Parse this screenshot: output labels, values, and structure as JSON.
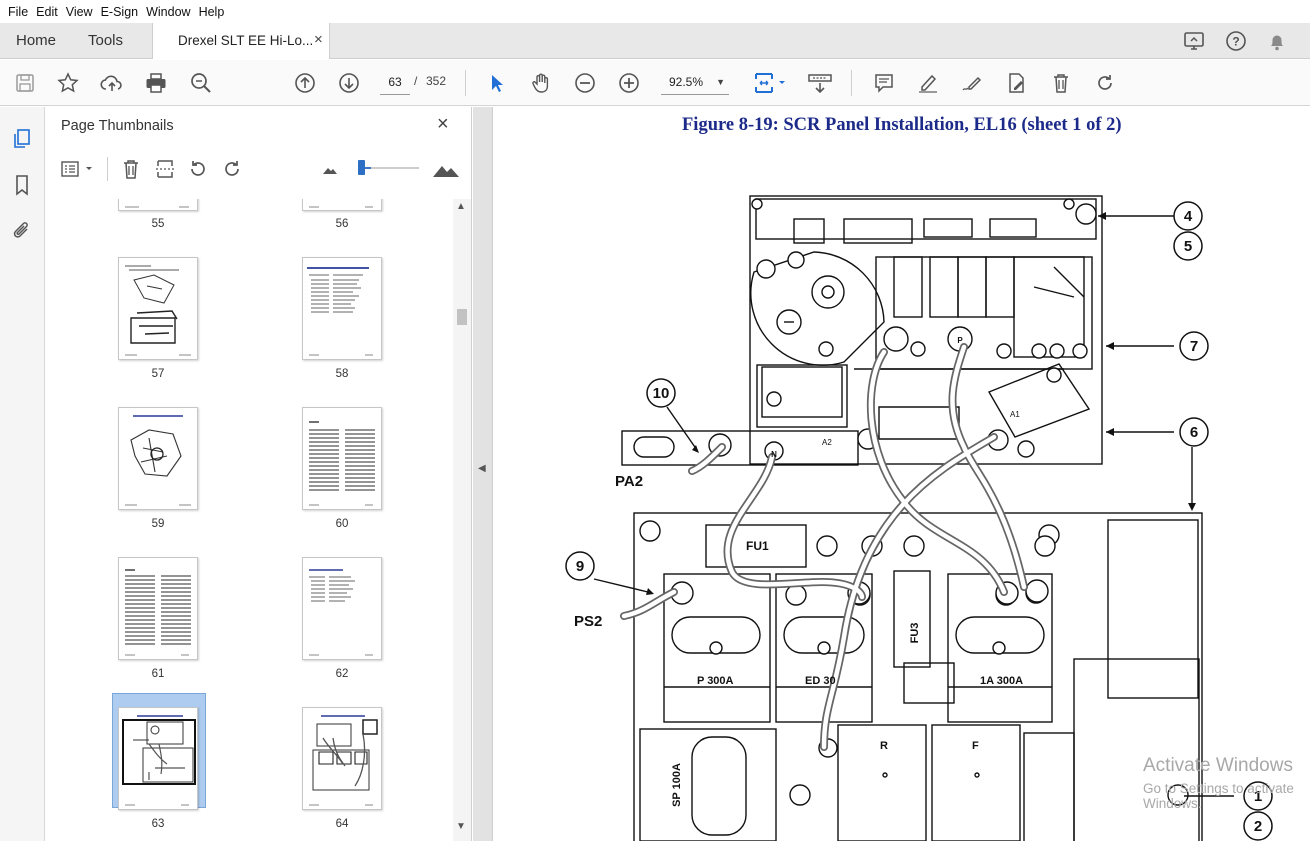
{
  "menu": [
    "File",
    "Edit",
    "View",
    "E-Sign",
    "Window",
    "Help"
  ],
  "tabs": {
    "home": "Home",
    "tools": "Tools",
    "document": "Drexel SLT EE Hi-Lo...",
    "close": "×"
  },
  "toolbar": {
    "current_page": "63",
    "page_separator": "/",
    "total_pages": "352",
    "zoom": "92.5%"
  },
  "panel": {
    "title": "Page Thumbnails",
    "close": "×",
    "zoom_slider_level": 0.1,
    "thumbnails": [
      {
        "page": "55"
      },
      {
        "page": "56"
      },
      {
        "page": "57"
      },
      {
        "page": "58"
      },
      {
        "page": "59"
      },
      {
        "page": "60"
      },
      {
        "page": "61"
      },
      {
        "page": "62"
      },
      {
        "page": "63",
        "selected": true
      },
      {
        "page": "64"
      }
    ]
  },
  "document": {
    "figure_title": "Figure 8-19:  SCR Panel Installation, EL16 (sheet 1 of 2)",
    "callouts": [
      "1",
      "2",
      "4",
      "5",
      "6",
      "7",
      "9",
      "10"
    ],
    "labels": {
      "pa2": "PA2",
      "ps2": "PS2",
      "fu1": "FU1",
      "fu3": "FU3",
      "p300a": "P 300A",
      "ed30": "ED 30",
      "a1_300a": "1A 300A",
      "sp100a": "SP 100A",
      "r": "R",
      "f": "F",
      "a1": "A1",
      "a2": "A2",
      "n": "N",
      "p": "P"
    }
  },
  "watermark": {
    "line1": "Activate Windows",
    "line2": "Go to Settings to activate Windows."
  }
}
